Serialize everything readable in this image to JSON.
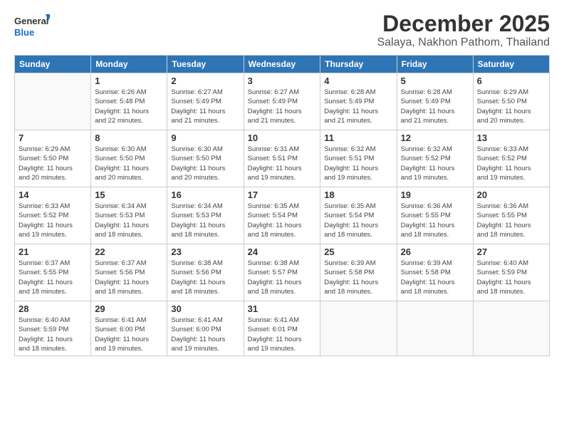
{
  "logo": {
    "line1": "General",
    "line2": "Blue"
  },
  "title": "December 2025",
  "subtitle": "Salaya, Nakhon Pathom, Thailand",
  "days_of_week": [
    "Sunday",
    "Monday",
    "Tuesday",
    "Wednesday",
    "Thursday",
    "Friday",
    "Saturday"
  ],
  "weeks": [
    [
      {
        "day": "",
        "info": ""
      },
      {
        "day": "1",
        "info": "Sunrise: 6:26 AM\nSunset: 5:48 PM\nDaylight: 11 hours\nand 22 minutes."
      },
      {
        "day": "2",
        "info": "Sunrise: 6:27 AM\nSunset: 5:49 PM\nDaylight: 11 hours\nand 21 minutes."
      },
      {
        "day": "3",
        "info": "Sunrise: 6:27 AM\nSunset: 5:49 PM\nDaylight: 11 hours\nand 21 minutes."
      },
      {
        "day": "4",
        "info": "Sunrise: 6:28 AM\nSunset: 5:49 PM\nDaylight: 11 hours\nand 21 minutes."
      },
      {
        "day": "5",
        "info": "Sunrise: 6:28 AM\nSunset: 5:49 PM\nDaylight: 11 hours\nand 21 minutes."
      },
      {
        "day": "6",
        "info": "Sunrise: 6:29 AM\nSunset: 5:50 PM\nDaylight: 11 hours\nand 20 minutes."
      }
    ],
    [
      {
        "day": "7",
        "info": "Sunrise: 6:29 AM\nSunset: 5:50 PM\nDaylight: 11 hours\nand 20 minutes."
      },
      {
        "day": "8",
        "info": "Sunrise: 6:30 AM\nSunset: 5:50 PM\nDaylight: 11 hours\nand 20 minutes."
      },
      {
        "day": "9",
        "info": "Sunrise: 6:30 AM\nSunset: 5:50 PM\nDaylight: 11 hours\nand 20 minutes."
      },
      {
        "day": "10",
        "info": "Sunrise: 6:31 AM\nSunset: 5:51 PM\nDaylight: 11 hours\nand 19 minutes."
      },
      {
        "day": "11",
        "info": "Sunrise: 6:32 AM\nSunset: 5:51 PM\nDaylight: 11 hours\nand 19 minutes."
      },
      {
        "day": "12",
        "info": "Sunrise: 6:32 AM\nSunset: 5:52 PM\nDaylight: 11 hours\nand 19 minutes."
      },
      {
        "day": "13",
        "info": "Sunrise: 6:33 AM\nSunset: 5:52 PM\nDaylight: 11 hours\nand 19 minutes."
      }
    ],
    [
      {
        "day": "14",
        "info": "Sunrise: 6:33 AM\nSunset: 5:52 PM\nDaylight: 11 hours\nand 19 minutes."
      },
      {
        "day": "15",
        "info": "Sunrise: 6:34 AM\nSunset: 5:53 PM\nDaylight: 11 hours\nand 18 minutes."
      },
      {
        "day": "16",
        "info": "Sunrise: 6:34 AM\nSunset: 5:53 PM\nDaylight: 11 hours\nand 18 minutes."
      },
      {
        "day": "17",
        "info": "Sunrise: 6:35 AM\nSunset: 5:54 PM\nDaylight: 11 hours\nand 18 minutes."
      },
      {
        "day": "18",
        "info": "Sunrise: 6:35 AM\nSunset: 5:54 PM\nDaylight: 11 hours\nand 18 minutes."
      },
      {
        "day": "19",
        "info": "Sunrise: 6:36 AM\nSunset: 5:55 PM\nDaylight: 11 hours\nand 18 minutes."
      },
      {
        "day": "20",
        "info": "Sunrise: 6:36 AM\nSunset: 5:55 PM\nDaylight: 11 hours\nand 18 minutes."
      }
    ],
    [
      {
        "day": "21",
        "info": "Sunrise: 6:37 AM\nSunset: 5:55 PM\nDaylight: 11 hours\nand 18 minutes."
      },
      {
        "day": "22",
        "info": "Sunrise: 6:37 AM\nSunset: 5:56 PM\nDaylight: 11 hours\nand 18 minutes."
      },
      {
        "day": "23",
        "info": "Sunrise: 6:38 AM\nSunset: 5:56 PM\nDaylight: 11 hours\nand 18 minutes."
      },
      {
        "day": "24",
        "info": "Sunrise: 6:38 AM\nSunset: 5:57 PM\nDaylight: 11 hours\nand 18 minutes."
      },
      {
        "day": "25",
        "info": "Sunrise: 6:39 AM\nSunset: 5:58 PM\nDaylight: 11 hours\nand 18 minutes."
      },
      {
        "day": "26",
        "info": "Sunrise: 6:39 AM\nSunset: 5:58 PM\nDaylight: 11 hours\nand 18 minutes."
      },
      {
        "day": "27",
        "info": "Sunrise: 6:40 AM\nSunset: 5:59 PM\nDaylight: 11 hours\nand 18 minutes."
      }
    ],
    [
      {
        "day": "28",
        "info": "Sunrise: 6:40 AM\nSunset: 5:59 PM\nDaylight: 11 hours\nand 18 minutes."
      },
      {
        "day": "29",
        "info": "Sunrise: 6:41 AM\nSunset: 6:00 PM\nDaylight: 11 hours\nand 19 minutes."
      },
      {
        "day": "30",
        "info": "Sunrise: 6:41 AM\nSunset: 6:00 PM\nDaylight: 11 hours\nand 19 minutes."
      },
      {
        "day": "31",
        "info": "Sunrise: 6:41 AM\nSunset: 6:01 PM\nDaylight: 11 hours\nand 19 minutes."
      },
      {
        "day": "",
        "info": ""
      },
      {
        "day": "",
        "info": ""
      },
      {
        "day": "",
        "info": ""
      }
    ]
  ]
}
